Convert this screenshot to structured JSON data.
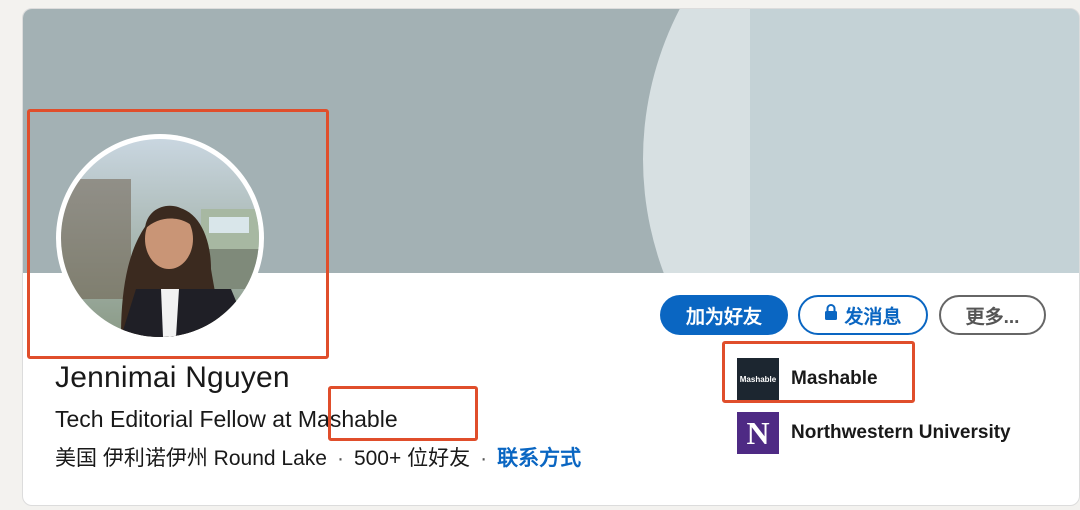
{
  "profile": {
    "name": "Jennimai Nguyen",
    "headline": "Tech Editorial Fellow at Mashable",
    "location": "美国 伊利诺伊州 Round Lake",
    "connections": "500+ 位好友",
    "separator": "·",
    "contact_link": "联系方式"
  },
  "actions": {
    "connect_label": "加为好友",
    "message_label": "发消息",
    "more_label": "更多..."
  },
  "organizations": [
    {
      "name": "Mashable",
      "logo_text": "Mashable",
      "logo_color": "#1c2630"
    },
    {
      "name": "Northwestern University",
      "logo_text": "N",
      "logo_color": "#4e2a84"
    }
  ],
  "colors": {
    "primary": "#0a66c2",
    "highlight": "#e04e2b"
  }
}
